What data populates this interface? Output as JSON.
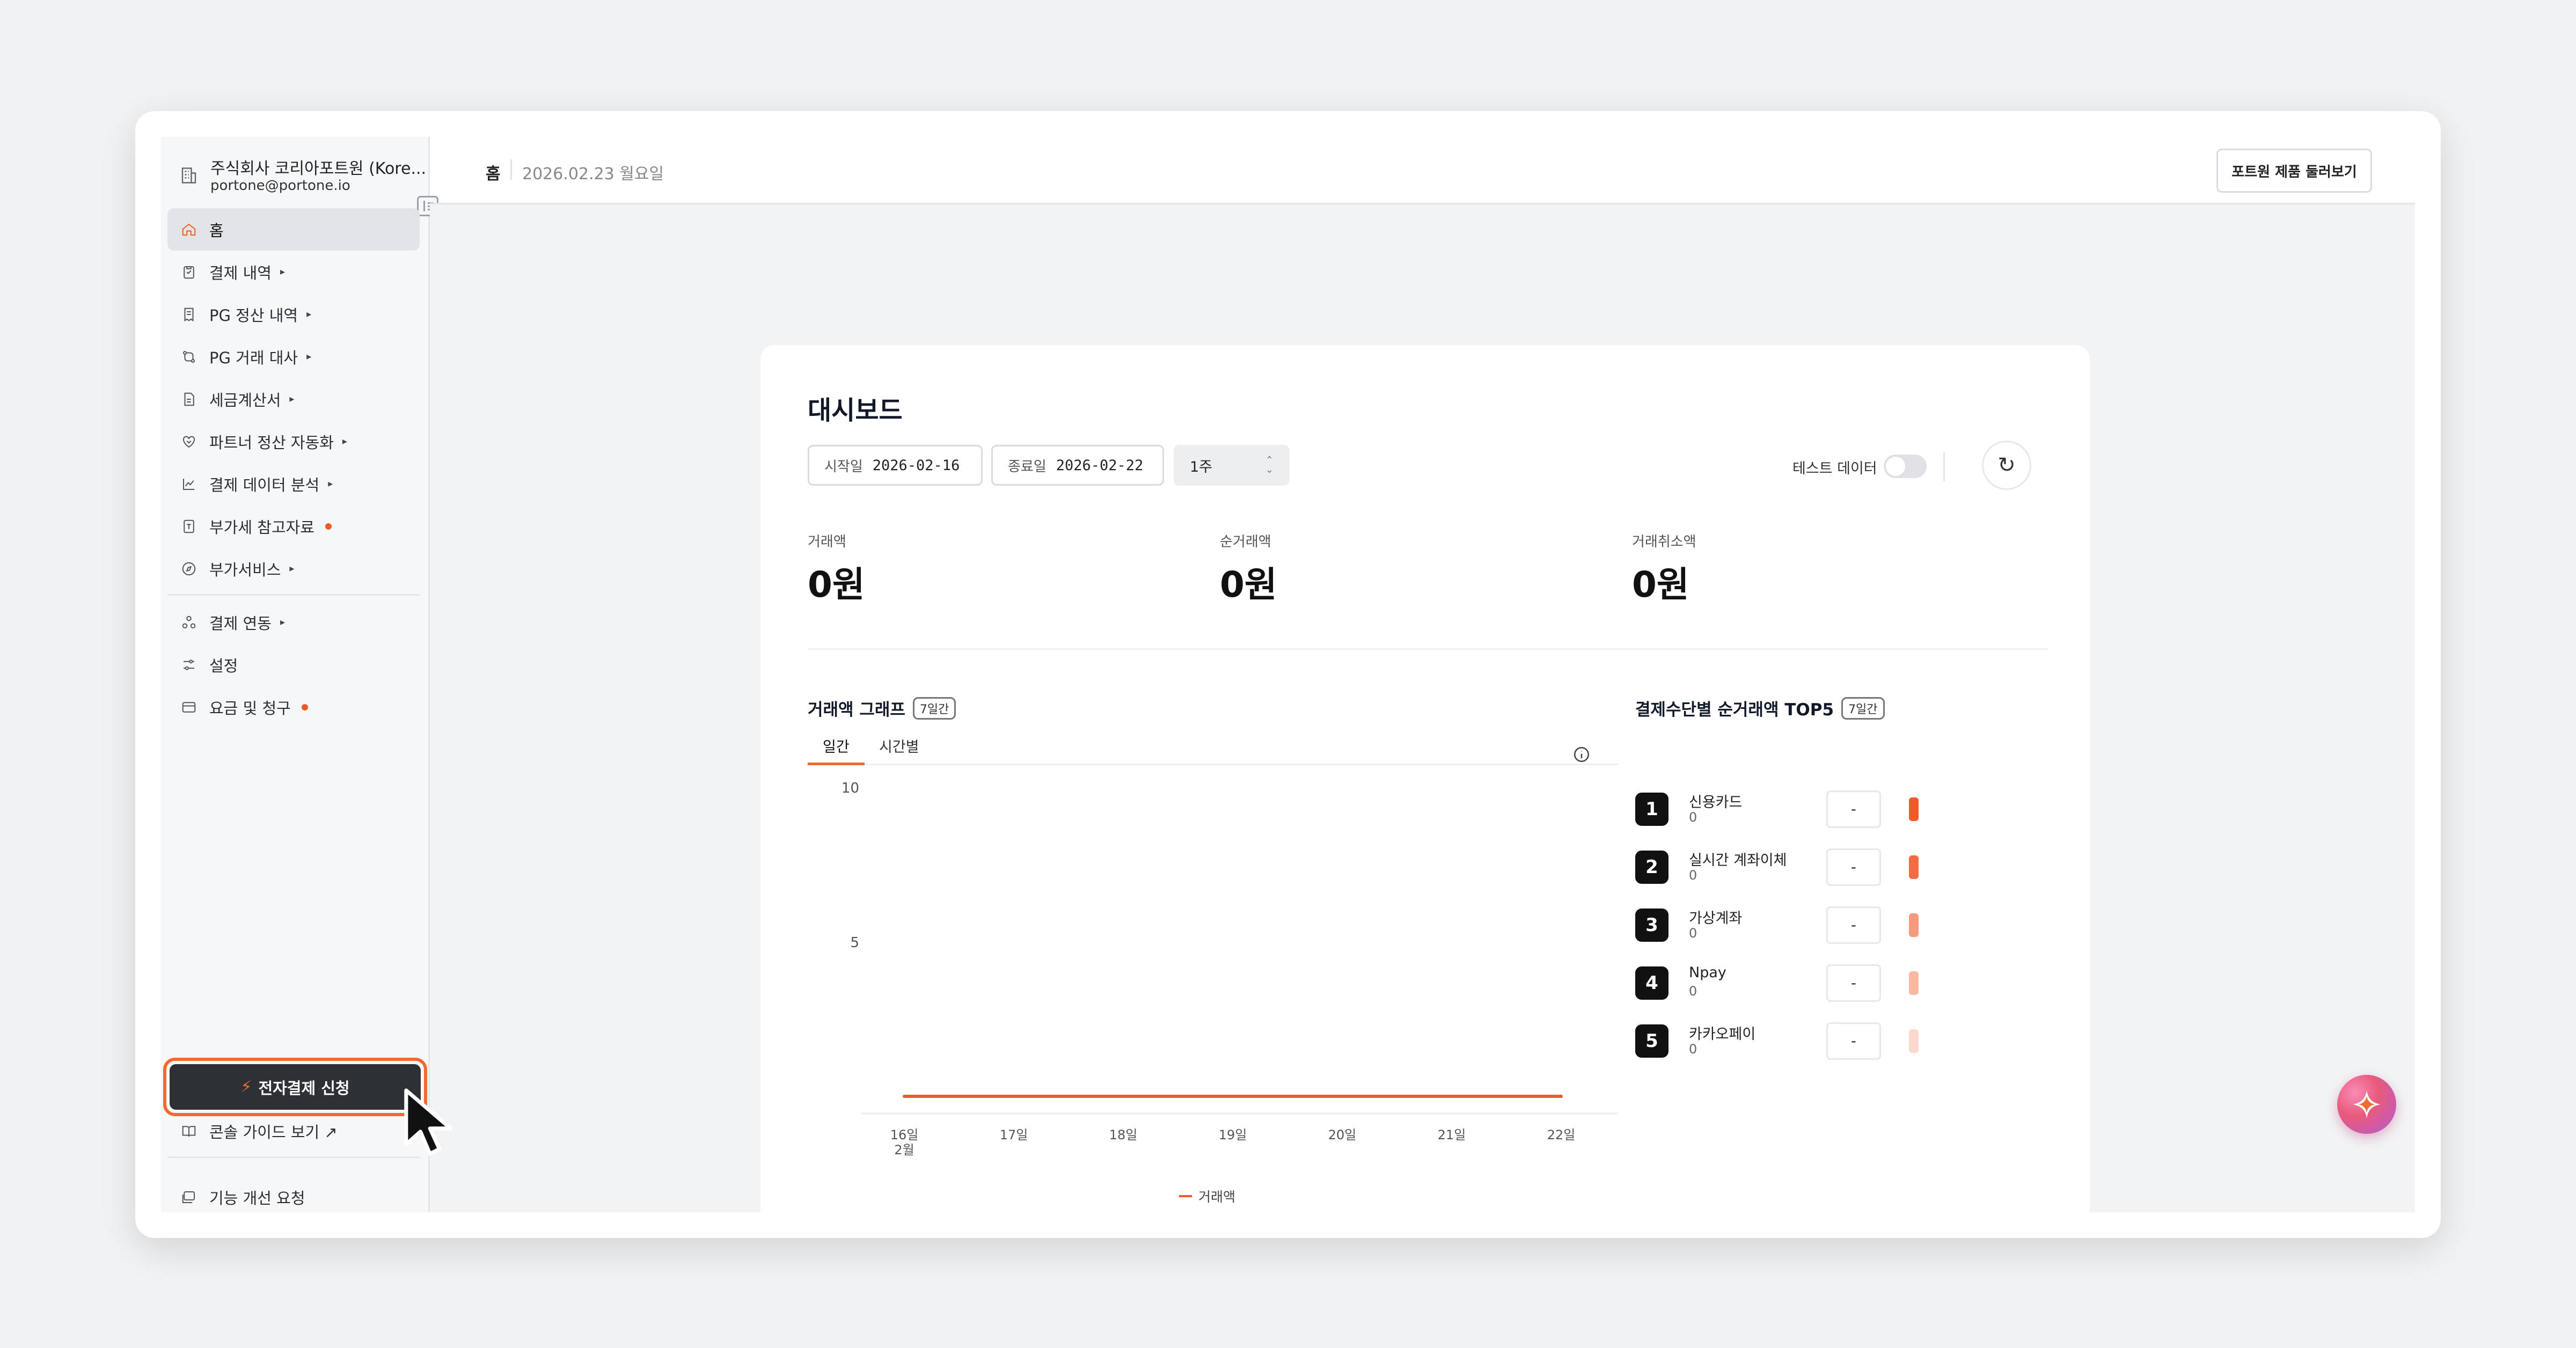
{
  "org": {
    "name": "주식회사 코리아포트원 (Kore...",
    "email": "portone@portone.io"
  },
  "sidebar": {
    "items": [
      {
        "label": "홈",
        "icon": "home-icon",
        "arrow": "",
        "dot": false,
        "active": true
      },
      {
        "label": "결제 내역",
        "icon": "clipboard-icon",
        "arrow": "▸",
        "dot": false
      },
      {
        "label": "PG 정산 내역",
        "icon": "receipt-icon",
        "arrow": "▸",
        "dot": false
      },
      {
        "label": "PG 거래 대사",
        "icon": "reconcile-icon",
        "arrow": "▸",
        "dot": false
      },
      {
        "label": "세금계산서",
        "icon": "document-icon",
        "arrow": "▸",
        "dot": false
      },
      {
        "label": "파트너 정산 자동화",
        "icon": "handshake-icon",
        "arrow": "▸",
        "dot": false
      },
      {
        "label": "결제 데이터 분석",
        "icon": "chart-line-icon",
        "arrow": "▸",
        "dot": false
      },
      {
        "label": "부가세 참고자료",
        "icon": "tax-doc-icon",
        "arrow": "",
        "dot": true
      },
      {
        "label": "부가서비스",
        "icon": "compass-icon",
        "arrow": "▸",
        "dot": false
      }
    ],
    "items2": [
      {
        "label": "결제 연동",
        "icon": "integration-icon",
        "arrow": "▸",
        "dot": false
      },
      {
        "label": "설정",
        "icon": "sliders-icon",
        "arrow": "",
        "dot": false
      },
      {
        "label": "요금 및 청구",
        "icon": "credit-card-icon",
        "arrow": "",
        "dot": true
      }
    ],
    "cta_label": "전자결제 신청",
    "guide_label": "콘솔 가이드 보기 ↗",
    "feedback_label": "기능 개선 요청"
  },
  "header": {
    "home": "홈",
    "date": "2026.02.23 월요일",
    "tour_button": "포트원 제품 둘러보기"
  },
  "dashboard": {
    "title": "대시보드",
    "start_label": "시작일",
    "start_date": "2026-02-16",
    "end_label": "종료일",
    "end_date": "2026-02-22",
    "period": "1주",
    "test_data_label": "테스트 데이터",
    "metrics": [
      {
        "label": "거래액",
        "value": "0원"
      },
      {
        "label": "순거래액",
        "value": "0원"
      },
      {
        "label": "거래취소액",
        "value": "0원"
      }
    ],
    "graph_title": "거래액 그래프",
    "graph_badge": "7일간",
    "tabs": [
      "일간",
      "시간별"
    ],
    "top5_title": "결제수단별 순거래액 TOP5",
    "top5_badge": "7일간",
    "top5": [
      {
        "rank": "1",
        "name": "신용카드",
        "value": "0",
        "box": "-",
        "color": "#f05a28"
      },
      {
        "rank": "2",
        "name": "실시간 계좌이체",
        "value": "0",
        "box": "-",
        "color": "#f26d43"
      },
      {
        "rank": "3",
        "name": "가상계좌",
        "value": "0",
        "box": "-",
        "color": "#f59a7c"
      },
      {
        "rank": "4",
        "name": "Npay",
        "value": "0",
        "box": "-",
        "color": "#f8b9a3"
      },
      {
        "rank": "5",
        "name": "카카오페이",
        "value": "0",
        "box": "-",
        "color": "#fbdacd"
      }
    ]
  },
  "chart_data": {
    "type": "line",
    "categories": [
      "16일",
      "17일",
      "18일",
      "19일",
      "20일",
      "21일",
      "22일"
    ],
    "month_label": "2월",
    "series": [
      {
        "name": "거래액",
        "values": [
          0,
          0,
          0,
          0,
          0,
          0,
          0
        ],
        "color": "#f05a28"
      }
    ],
    "yticks": [
      5,
      10
    ],
    "ylim": [
      0,
      10
    ],
    "grid": false,
    "legend": "bottom"
  }
}
